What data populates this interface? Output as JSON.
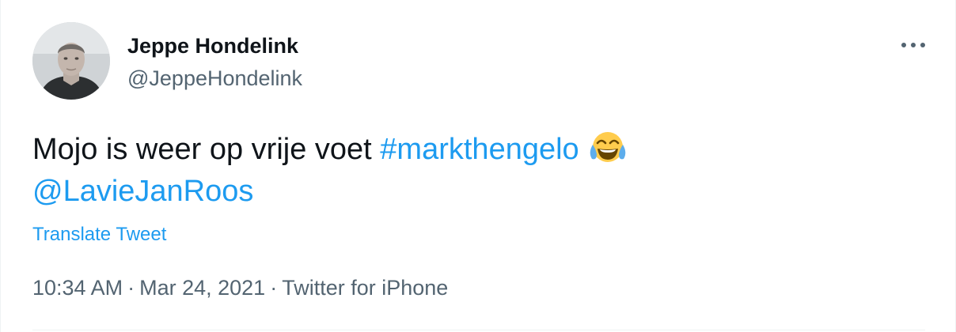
{
  "author": {
    "name": "Jeppe Hondelink",
    "handle": "@JeppeHondelink"
  },
  "menu": {
    "icon": "more-horizontal-icon"
  },
  "tweet": {
    "text_main": "Mojo is weer op vrije voet ",
    "hashtag": "#markthengelo",
    "emoji": "face-with-tears-of-joy-icon",
    "mention": "@LavieJanRoos"
  },
  "translate_label": "Translate Tweet",
  "meta": {
    "time": "10:34 AM",
    "date": "Mar 24, 2021",
    "source": "Twitter for iPhone",
    "separator": "·"
  },
  "colors": {
    "link": "#1d9bf0",
    "secondary_text": "#536471",
    "primary_text": "#0f1419"
  }
}
